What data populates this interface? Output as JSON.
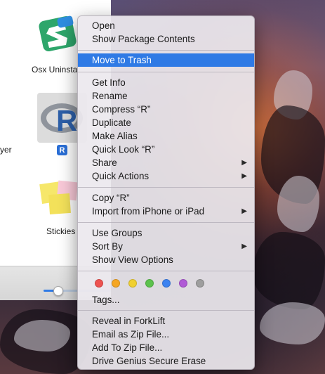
{
  "finder": {
    "items": [
      {
        "label": "Osx Uninsta"
      },
      {
        "label": "yer"
      },
      {
        "label": "R"
      },
      {
        "label": "Stickies"
      }
    ]
  },
  "context_menu": {
    "group1": [
      "Open",
      "Show Package Contents"
    ],
    "highlighted": "Move to Trash",
    "group2": [
      "Get Info",
      "Rename",
      "Compress “R”",
      "Duplicate",
      "Make Alias",
      "Quick Look “R”",
      "Share",
      "Quick Actions"
    ],
    "group3": [
      "Copy “R”",
      "Import from iPhone or iPad"
    ],
    "group4": [
      "Use Groups",
      "Sort By",
      "Show View Options"
    ],
    "tags_label": "Tags...",
    "tag_colors": [
      "#ee5350",
      "#f5a623",
      "#f0d030",
      "#5cc24d",
      "#3b82f0",
      "#b05ad6",
      "#9e9e9e"
    ],
    "group5": [
      "Reveal in ForkLift",
      "Email as Zip File...",
      "Add To Zip File...",
      "Drive Genius Secure Erase"
    ],
    "submenu_arrow": "▶"
  }
}
